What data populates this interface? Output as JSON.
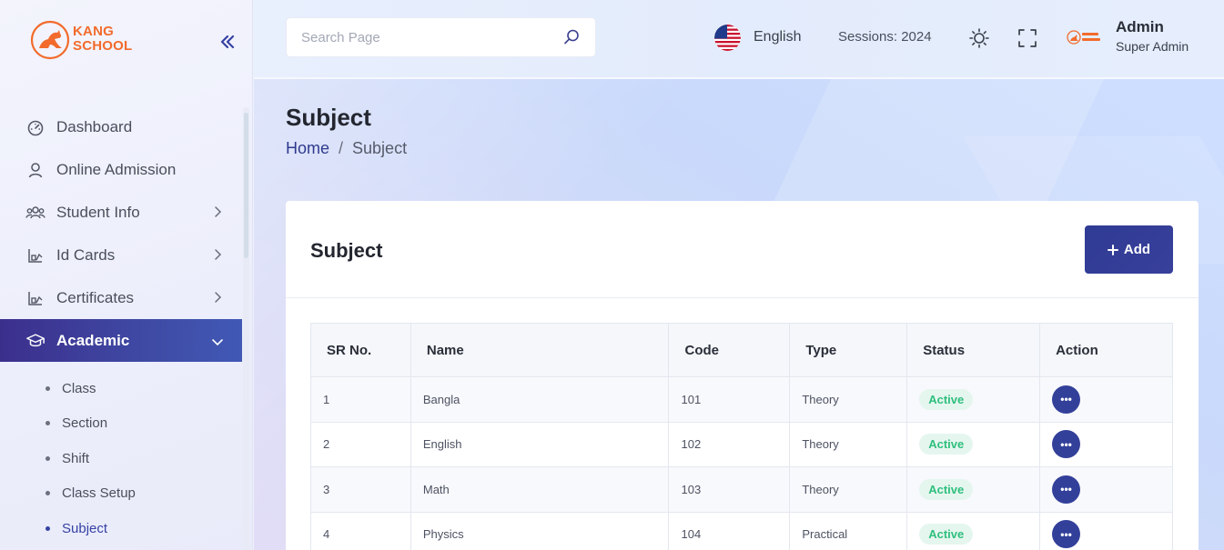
{
  "brand": {
    "line1": "KANG",
    "line2": "SCHOOL"
  },
  "colors": {
    "primary": "#33409a",
    "accent": "#f26b2c",
    "success": "#2fbf7d"
  },
  "sidebar": {
    "items": [
      {
        "label": "Dashboard",
        "icon": "dashboard-icon"
      },
      {
        "label": "Online Admission",
        "icon": "user-icon"
      },
      {
        "label": "Student Info",
        "icon": "users-icon"
      },
      {
        "label": "Id Cards",
        "icon": "cards-icon"
      },
      {
        "label": "Certificates",
        "icon": "certificate-icon"
      },
      {
        "label": "Academic",
        "icon": "graduation-cap-icon"
      }
    ],
    "sub_items": [
      "Class",
      "Section",
      "Shift",
      "Class Setup",
      "Subject"
    ]
  },
  "header": {
    "search_placeholder": "Search Page",
    "language": "English",
    "sessions": "Sessions: 2024",
    "user_name": "Admin",
    "user_role": "Super Admin"
  },
  "page": {
    "title": "Subject",
    "breadcrumb": [
      "Home",
      "Subject"
    ],
    "breadcrumb_sep": "/"
  },
  "card": {
    "title": "Subject",
    "add_label": "Add",
    "columns": [
      "SR No.",
      "Name",
      "Code",
      "Type",
      "Status",
      "Action"
    ],
    "rows": [
      {
        "sr": "1",
        "name": "Bangla",
        "code": "101",
        "type": "Theory",
        "status": "Active"
      },
      {
        "sr": "2",
        "name": "English",
        "code": "102",
        "type": "Theory",
        "status": "Active"
      },
      {
        "sr": "3",
        "name": "Math",
        "code": "103",
        "type": "Theory",
        "status": "Active"
      },
      {
        "sr": "4",
        "name": "Physics",
        "code": "104",
        "type": "Practical",
        "status": "Active"
      }
    ],
    "action_glyph": "•••"
  }
}
